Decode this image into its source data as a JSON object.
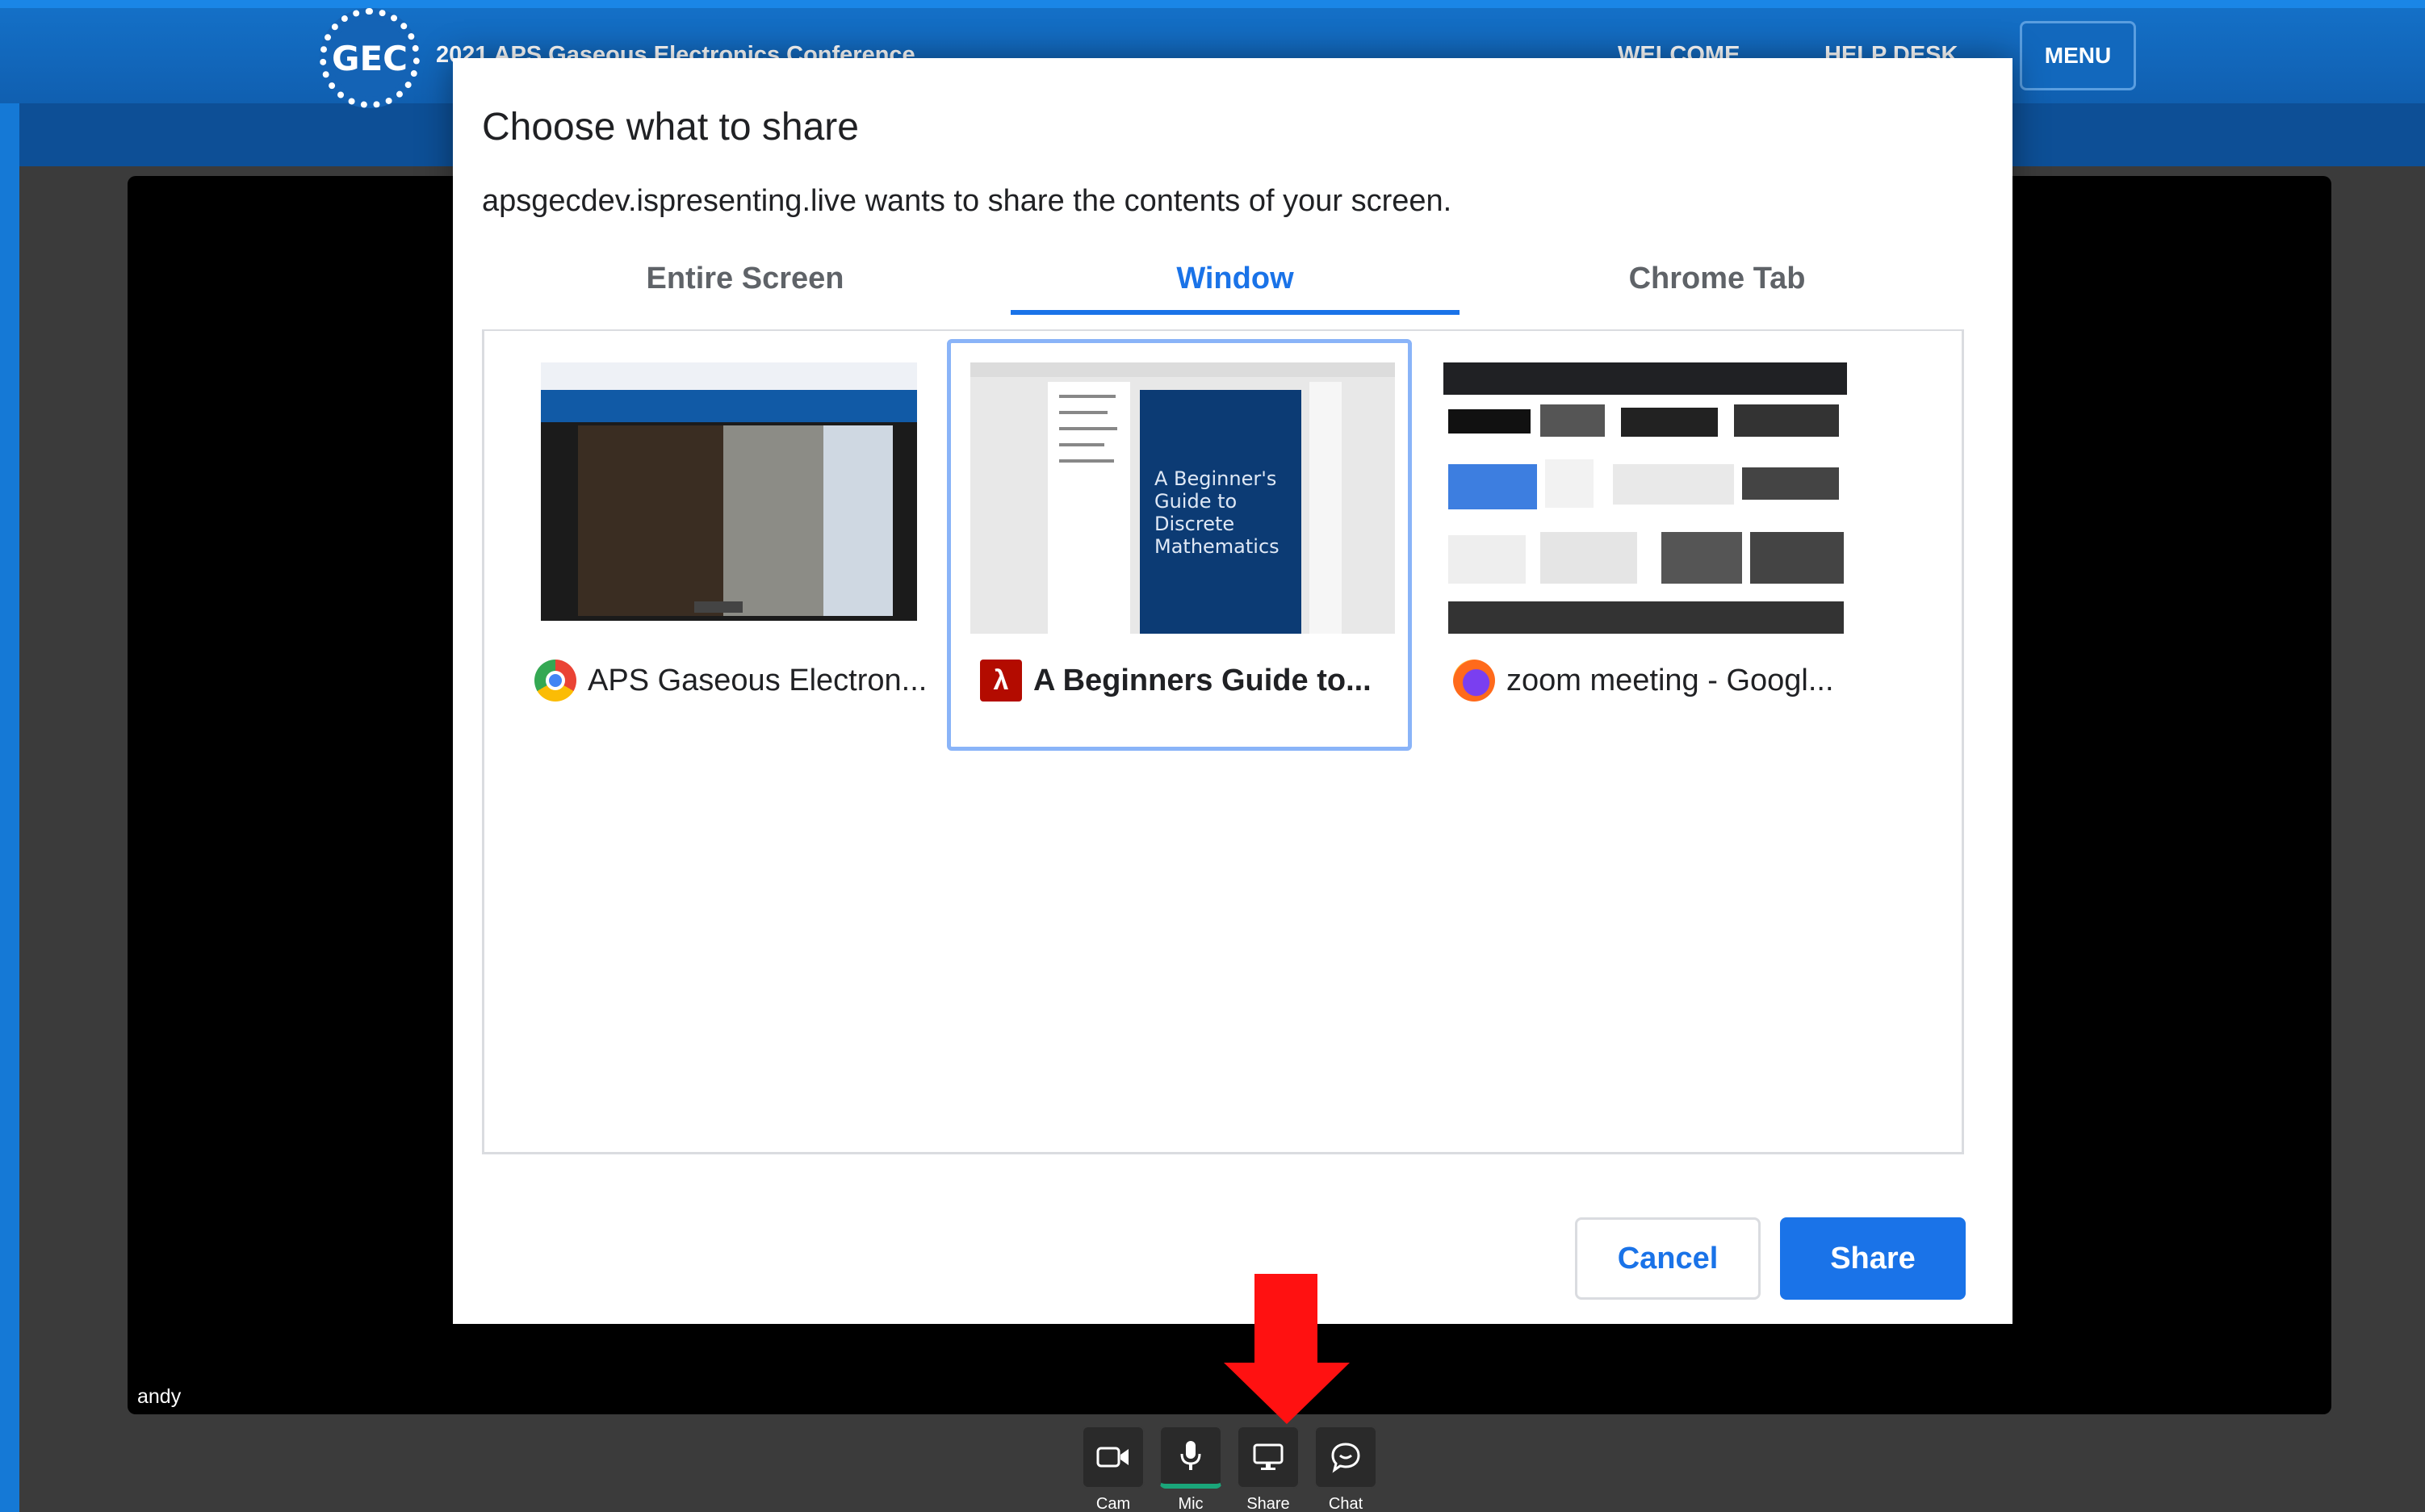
{
  "header": {
    "logo_text": "GEC",
    "conference_title": "2021 APS Gaseous Electronics Conference",
    "nav": [
      "WELCOME",
      "HELP DESK"
    ],
    "menu_label": "MENU"
  },
  "stage": {
    "participant_name": "andy"
  },
  "dialog": {
    "title": "Choose what to share",
    "subtitle": "apsgecdev.ispresenting.live wants to share the contents of your screen.",
    "tabs": [
      {
        "label": "Entire Screen",
        "active": false
      },
      {
        "label": "Window",
        "active": true
      },
      {
        "label": "Chrome Tab",
        "active": false
      }
    ],
    "windows": [
      {
        "label": "APS Gaseous Electron...",
        "icon": "chrome-icon",
        "selected": false
      },
      {
        "label": "A Beginners Guide to...",
        "icon": "acrobat-icon",
        "selected": true,
        "thumb_text": "A Beginner's Guide to Discrete Mathematics"
      },
      {
        "label": "zoom meeting - Googl...",
        "icon": "firefox-icon",
        "selected": false
      }
    ],
    "cancel_label": "Cancel",
    "share_label": "Share"
  },
  "toolbar": {
    "buttons": [
      {
        "label": "Cam",
        "icon": "camera-icon"
      },
      {
        "label": "Mic",
        "icon": "microphone-icon"
      },
      {
        "label": "Share",
        "icon": "screen-share-icon"
      },
      {
        "label": "Chat",
        "icon": "chat-icon"
      }
    ]
  },
  "colors": {
    "accent": "#1a73e8",
    "header_blue": "#1470c7",
    "arrow_red": "#ff1111"
  }
}
